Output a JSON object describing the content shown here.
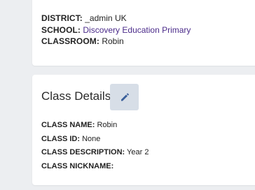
{
  "info": {
    "district_label": "DISTRICT:",
    "district_value": "_admin UK",
    "school_label": "SCHOOL:",
    "school_value": "Discovery Education Primary",
    "classroom_label": "CLASSROOM:",
    "classroom_value": "Robin"
  },
  "class_details": {
    "title": "Class Details",
    "edit_icon": "pencil-icon",
    "fields": [
      {
        "label": "CLASS NAME:",
        "value": "Robin"
      },
      {
        "label": "CLASS ID:",
        "value": "None"
      },
      {
        "label": "CLASS DESCRIPTION:",
        "value": "Year 2"
      },
      {
        "label": "CLASS NICKNAME:",
        "value": ""
      }
    ]
  },
  "colors": {
    "background": "#eceef1",
    "link": "#4b2b8a",
    "edit_button_bg": "#d7dee7",
    "edit_icon": "#3a5f9a"
  }
}
